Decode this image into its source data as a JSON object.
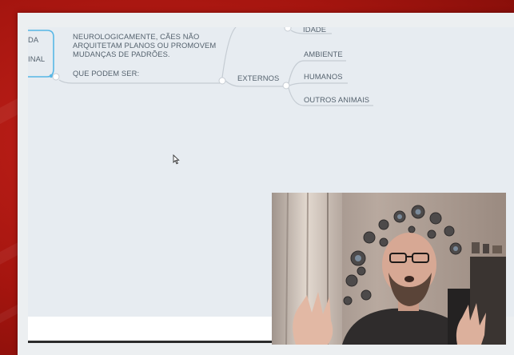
{
  "mindmap": {
    "partial_node_top": "DA",
    "partial_node_bottom": "INAL",
    "note_lines": [
      "NEUROLOGICAMENTE, CÃES NÃO",
      "ARQUITETAM PLANOS OU PROMOVEM",
      "MUDANÇAS DE PADRÕES."
    ],
    "question": "QUE PODEM SER:",
    "top_partial": "IDADE",
    "branch": "EXTERNOS",
    "children": [
      "AMBIENTE",
      "HUMANOS",
      "OUTROS ANIMAIS"
    ]
  },
  "icons": {
    "cursor": "mouse-pointer-icon",
    "webcam": "webcam-video-feed"
  },
  "colors": {
    "background_red": "#b11a13",
    "canvas": "#e7ecf1",
    "selected_node_border": "#57b7e6",
    "connector": "#c5ccd3",
    "text": "#55626e"
  }
}
